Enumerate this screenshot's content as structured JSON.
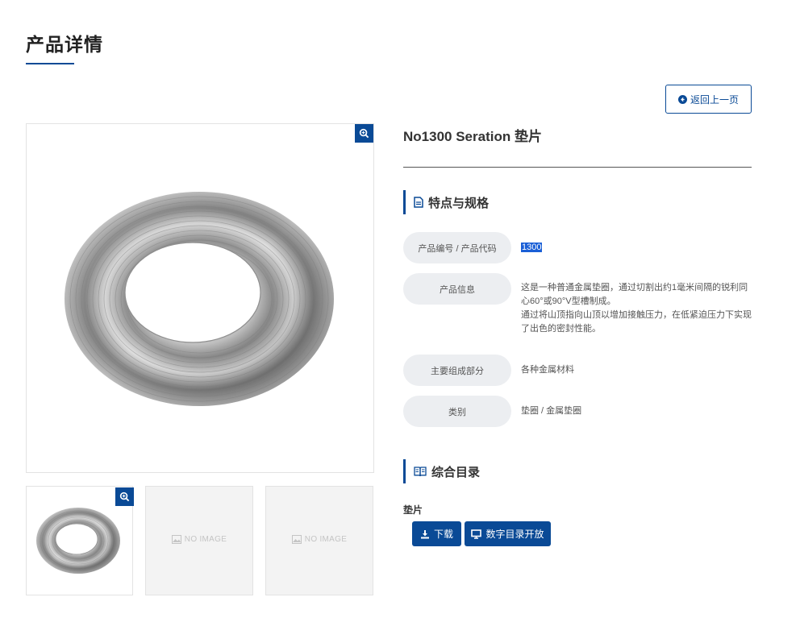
{
  "page": {
    "title": "产品详情"
  },
  "back_button": {
    "label": "返回上一页"
  },
  "gallery": {
    "no_image_label": "NO IMAGE"
  },
  "product": {
    "name": "No1300 Seration 垫片",
    "spec_section_title": "特点与规格",
    "specs": [
      {
        "label": "产品编号 / 产品代码",
        "value": "1300"
      },
      {
        "label": "产品信息",
        "value_lines": [
          "这是一种普通金属垫圈，通过切割出约1毫米间隔的锐利同心60°或90°V型槽制成。",
          "通过将山顶指向山顶以增加接触压力，在低紧迫压力下实现了出色的密封性能。"
        ]
      },
      {
        "label": "主要组成部分",
        "value": "各种金属材料"
      },
      {
        "label": "类别",
        "value": "垫圈 / 金属垫圈"
      }
    ]
  },
  "catalog": {
    "title": "综合目录",
    "subtitle": "垫片",
    "download_label": "下载",
    "digital_label": "数字目录开放"
  },
  "colors": {
    "accent": "#0a4a96",
    "label_bg": "#eceef1",
    "highlight": "#1a5fd6"
  }
}
